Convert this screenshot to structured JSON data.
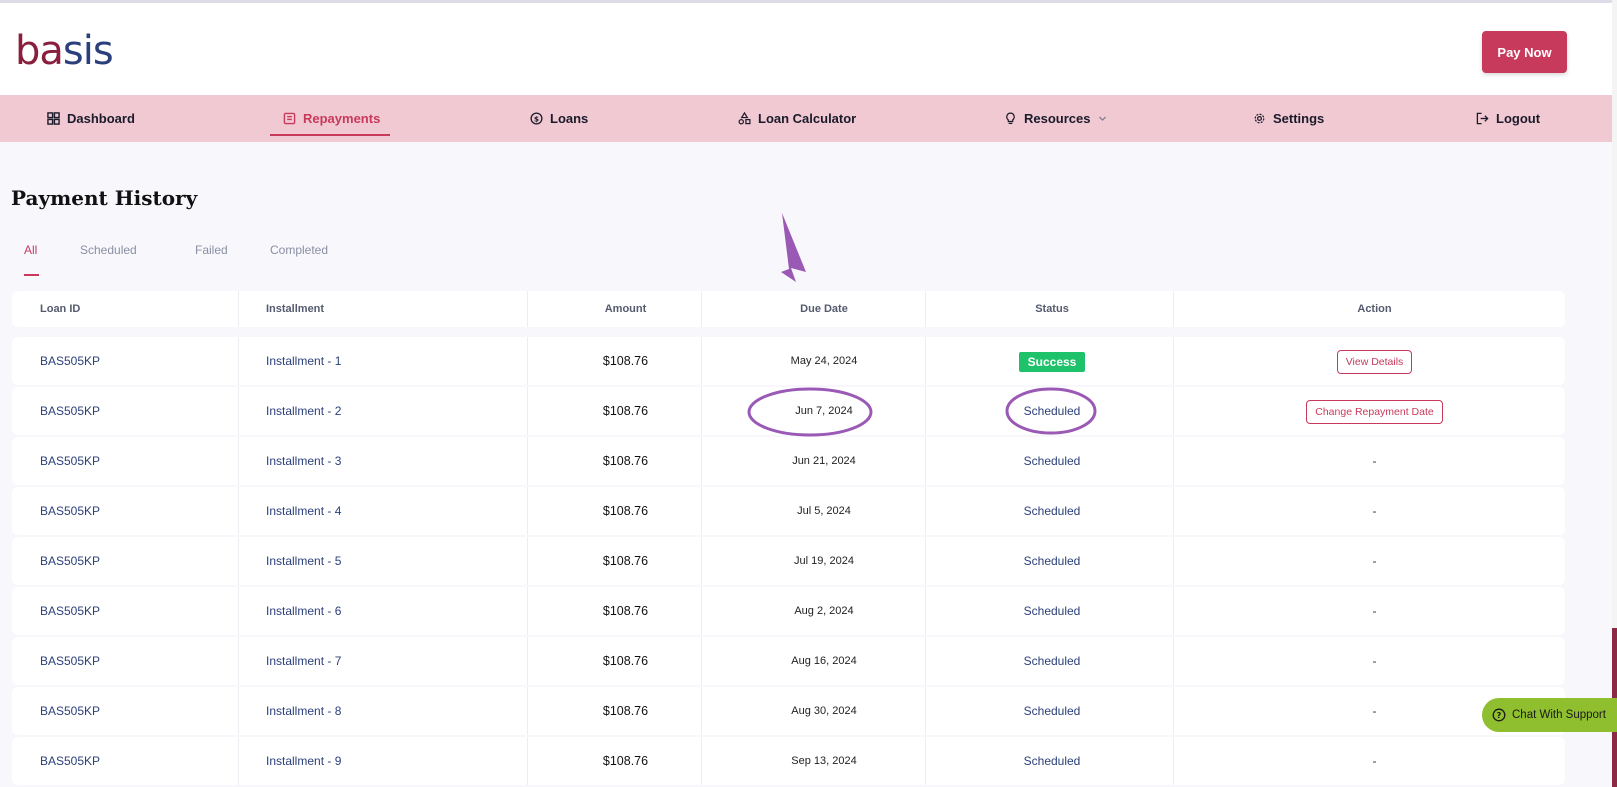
{
  "brand": {
    "logo_part1": "ba",
    "logo_part2": "sis"
  },
  "header": {
    "pay_now_label": "Pay Now"
  },
  "nav": {
    "items": [
      {
        "label": "Dashboard",
        "icon": "dashboard-icon"
      },
      {
        "label": "Repayments",
        "icon": "repayments-icon",
        "active": true
      },
      {
        "label": "Loans",
        "icon": "dollar-circle-icon"
      },
      {
        "label": "Loan Calculator",
        "icon": "shapes-icon"
      },
      {
        "label": "Resources",
        "icon": "lightbulb-icon",
        "has_dropdown": true
      },
      {
        "label": "Settings",
        "icon": "gear-icon"
      },
      {
        "label": "Logout",
        "icon": "logout-icon"
      }
    ]
  },
  "page": {
    "title": "Payment History"
  },
  "tabs": [
    {
      "label": "All",
      "active": true
    },
    {
      "label": "Scheduled"
    },
    {
      "label": "Failed"
    },
    {
      "label": "Completed"
    }
  ],
  "table": {
    "columns": [
      "Loan ID",
      "Installment",
      "Amount",
      "Due Date",
      "Status",
      "Action"
    ],
    "rows": [
      {
        "loan_id": "BAS505KP",
        "installment": "Installment - 1",
        "amount": "$108.76",
        "due_date": "May 24, 2024",
        "status": "Success",
        "action": "View Details"
      },
      {
        "loan_id": "BAS505KP",
        "installment": "Installment - 2",
        "amount": "$108.76",
        "due_date": "Jun 7, 2024",
        "status": "Scheduled",
        "action": "Change Repayment Date"
      },
      {
        "loan_id": "BAS505KP",
        "installment": "Installment - 3",
        "amount": "$108.76",
        "due_date": "Jun 21, 2024",
        "status": "Scheduled",
        "action": "-"
      },
      {
        "loan_id": "BAS505KP",
        "installment": "Installment - 4",
        "amount": "$108.76",
        "due_date": "Jul 5, 2024",
        "status": "Scheduled",
        "action": "-"
      },
      {
        "loan_id": "BAS505KP",
        "installment": "Installment - 5",
        "amount": "$108.76",
        "due_date": "Jul 19, 2024",
        "status": "Scheduled",
        "action": "-"
      },
      {
        "loan_id": "BAS505KP",
        "installment": "Installment - 6",
        "amount": "$108.76",
        "due_date": "Aug 2, 2024",
        "status": "Scheduled",
        "action": "-"
      },
      {
        "loan_id": "BAS505KP",
        "installment": "Installment - 7",
        "amount": "$108.76",
        "due_date": "Aug 16, 2024",
        "status": "Scheduled",
        "action": "-"
      },
      {
        "loan_id": "BAS505KP",
        "installment": "Installment - 8",
        "amount": "$108.76",
        "due_date": "Aug 30, 2024",
        "status": "Scheduled",
        "action": "-"
      },
      {
        "loan_id": "BAS505KP",
        "installment": "Installment - 9",
        "amount": "$108.76",
        "due_date": "Sep 13, 2024",
        "status": "Scheduled",
        "action": "-"
      }
    ]
  },
  "support": {
    "chat_label": "Chat With Support",
    "icon": "help-circle-icon"
  },
  "colors": {
    "accent": "#c73a5c",
    "nav_bg": "#f1c9d2",
    "success": "#1ec26b",
    "chat_bg": "#8fbf2e",
    "annotation": "#9b59b6"
  }
}
